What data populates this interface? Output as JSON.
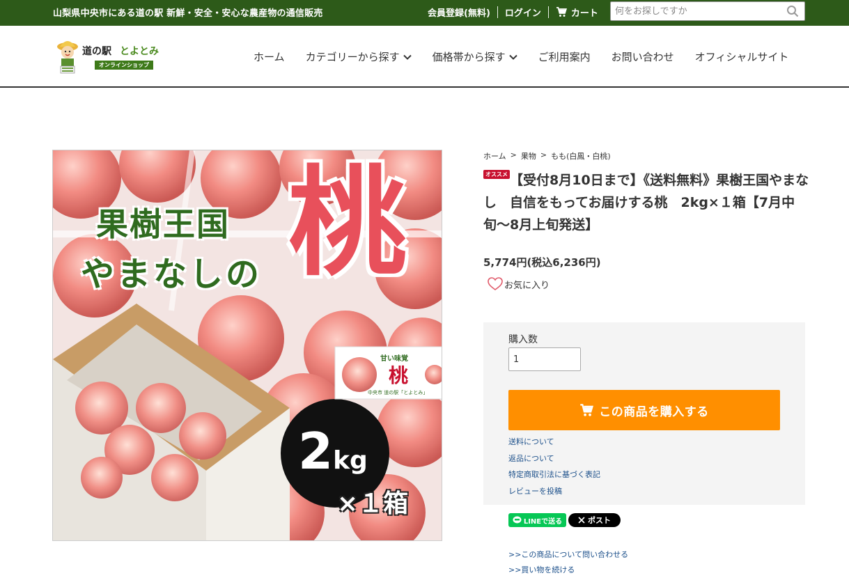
{
  "topbar": {
    "tagline": "山梨県中央市にある道の駅 新鮮・安全・安心な農産物の通信販売",
    "register": "会員登録(無料)",
    "login": "ログイン",
    "cart": "カート",
    "search_placeholder": "何をお探しですか"
  },
  "logo": {
    "name_prefix": "道の駅",
    "name_suffix": "とよとみ",
    "badge": "オンラインショップ"
  },
  "nav": {
    "home": "ホーム",
    "category": "カテゴリーから探す",
    "price_range": "価格帯から探す",
    "guide": "ご利用案内",
    "contact": "お問い合わせ",
    "official": "オフィシャルサイト"
  },
  "image": {
    "title_line1": "果樹王国",
    "title_line2": "やまなしの",
    "big_char": "桃",
    "weight_num": "2",
    "weight_unit": "kg",
    "weight_count": "×１箱",
    "sticker_top": "甘い味覚",
    "sticker_main": "桃",
    "sticker_small": "中央市 道の駅「とよとみ」"
  },
  "breadcrumb": [
    "ホーム",
    "果物",
    "もも(白鳳・白桃)"
  ],
  "breadcrumb_sep": ">",
  "product": {
    "tag": "オススメ",
    "title": "【受付8月10日まで】《送料無料》果樹王国やまなし　自信をもってお届けする桃　2kg×１箱【7月中旬〜8月上旬発送】",
    "price": "5,774円(税込6,236円)",
    "favorite": "お気に入り"
  },
  "buybox": {
    "qty_label": "購入数",
    "qty_value": "1",
    "buy_button": "この商品を購入する",
    "links": [
      "送料について",
      "返品について",
      "特定商取引法に基づく表記",
      "レビューを投稿"
    ]
  },
  "share": {
    "line": "LINEで送る",
    "x": "ポスト"
  },
  "bottom_links": [
    ">>この商品について問い合わせる",
    ">>買い物を続ける"
  ]
}
